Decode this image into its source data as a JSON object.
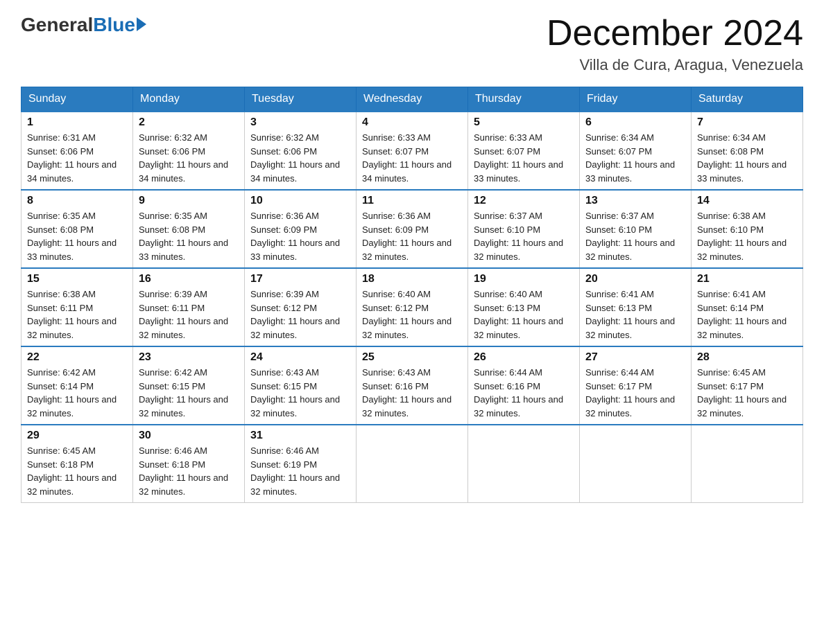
{
  "header": {
    "logo_general": "General",
    "logo_blue": "Blue",
    "month_title": "December 2024",
    "location": "Villa de Cura, Aragua, Venezuela"
  },
  "days_of_week": [
    "Sunday",
    "Monday",
    "Tuesday",
    "Wednesday",
    "Thursday",
    "Friday",
    "Saturday"
  ],
  "weeks": [
    [
      {
        "day": "1",
        "sunrise": "6:31 AM",
        "sunset": "6:06 PM",
        "daylight": "11 hours and 34 minutes."
      },
      {
        "day": "2",
        "sunrise": "6:32 AM",
        "sunset": "6:06 PM",
        "daylight": "11 hours and 34 minutes."
      },
      {
        "day": "3",
        "sunrise": "6:32 AM",
        "sunset": "6:06 PM",
        "daylight": "11 hours and 34 minutes."
      },
      {
        "day": "4",
        "sunrise": "6:33 AM",
        "sunset": "6:07 PM",
        "daylight": "11 hours and 34 minutes."
      },
      {
        "day": "5",
        "sunrise": "6:33 AM",
        "sunset": "6:07 PM",
        "daylight": "11 hours and 33 minutes."
      },
      {
        "day": "6",
        "sunrise": "6:34 AM",
        "sunset": "6:07 PM",
        "daylight": "11 hours and 33 minutes."
      },
      {
        "day": "7",
        "sunrise": "6:34 AM",
        "sunset": "6:08 PM",
        "daylight": "11 hours and 33 minutes."
      }
    ],
    [
      {
        "day": "8",
        "sunrise": "6:35 AM",
        "sunset": "6:08 PM",
        "daylight": "11 hours and 33 minutes."
      },
      {
        "day": "9",
        "sunrise": "6:35 AM",
        "sunset": "6:08 PM",
        "daylight": "11 hours and 33 minutes."
      },
      {
        "day": "10",
        "sunrise": "6:36 AM",
        "sunset": "6:09 PM",
        "daylight": "11 hours and 33 minutes."
      },
      {
        "day": "11",
        "sunrise": "6:36 AM",
        "sunset": "6:09 PM",
        "daylight": "11 hours and 32 minutes."
      },
      {
        "day": "12",
        "sunrise": "6:37 AM",
        "sunset": "6:10 PM",
        "daylight": "11 hours and 32 minutes."
      },
      {
        "day": "13",
        "sunrise": "6:37 AM",
        "sunset": "6:10 PM",
        "daylight": "11 hours and 32 minutes."
      },
      {
        "day": "14",
        "sunrise": "6:38 AM",
        "sunset": "6:10 PM",
        "daylight": "11 hours and 32 minutes."
      }
    ],
    [
      {
        "day": "15",
        "sunrise": "6:38 AM",
        "sunset": "6:11 PM",
        "daylight": "11 hours and 32 minutes."
      },
      {
        "day": "16",
        "sunrise": "6:39 AM",
        "sunset": "6:11 PM",
        "daylight": "11 hours and 32 minutes."
      },
      {
        "day": "17",
        "sunrise": "6:39 AM",
        "sunset": "6:12 PM",
        "daylight": "11 hours and 32 minutes."
      },
      {
        "day": "18",
        "sunrise": "6:40 AM",
        "sunset": "6:12 PM",
        "daylight": "11 hours and 32 minutes."
      },
      {
        "day": "19",
        "sunrise": "6:40 AM",
        "sunset": "6:13 PM",
        "daylight": "11 hours and 32 minutes."
      },
      {
        "day": "20",
        "sunrise": "6:41 AM",
        "sunset": "6:13 PM",
        "daylight": "11 hours and 32 minutes."
      },
      {
        "day": "21",
        "sunrise": "6:41 AM",
        "sunset": "6:14 PM",
        "daylight": "11 hours and 32 minutes."
      }
    ],
    [
      {
        "day": "22",
        "sunrise": "6:42 AM",
        "sunset": "6:14 PM",
        "daylight": "11 hours and 32 minutes."
      },
      {
        "day": "23",
        "sunrise": "6:42 AM",
        "sunset": "6:15 PM",
        "daylight": "11 hours and 32 minutes."
      },
      {
        "day": "24",
        "sunrise": "6:43 AM",
        "sunset": "6:15 PM",
        "daylight": "11 hours and 32 minutes."
      },
      {
        "day": "25",
        "sunrise": "6:43 AM",
        "sunset": "6:16 PM",
        "daylight": "11 hours and 32 minutes."
      },
      {
        "day": "26",
        "sunrise": "6:44 AM",
        "sunset": "6:16 PM",
        "daylight": "11 hours and 32 minutes."
      },
      {
        "day": "27",
        "sunrise": "6:44 AM",
        "sunset": "6:17 PM",
        "daylight": "11 hours and 32 minutes."
      },
      {
        "day": "28",
        "sunrise": "6:45 AM",
        "sunset": "6:17 PM",
        "daylight": "11 hours and 32 minutes."
      }
    ],
    [
      {
        "day": "29",
        "sunrise": "6:45 AM",
        "sunset": "6:18 PM",
        "daylight": "11 hours and 32 minutes."
      },
      {
        "day": "30",
        "sunrise": "6:46 AM",
        "sunset": "6:18 PM",
        "daylight": "11 hours and 32 minutes."
      },
      {
        "day": "31",
        "sunrise": "6:46 AM",
        "sunset": "6:19 PM",
        "daylight": "11 hours and 32 minutes."
      },
      null,
      null,
      null,
      null
    ]
  ]
}
